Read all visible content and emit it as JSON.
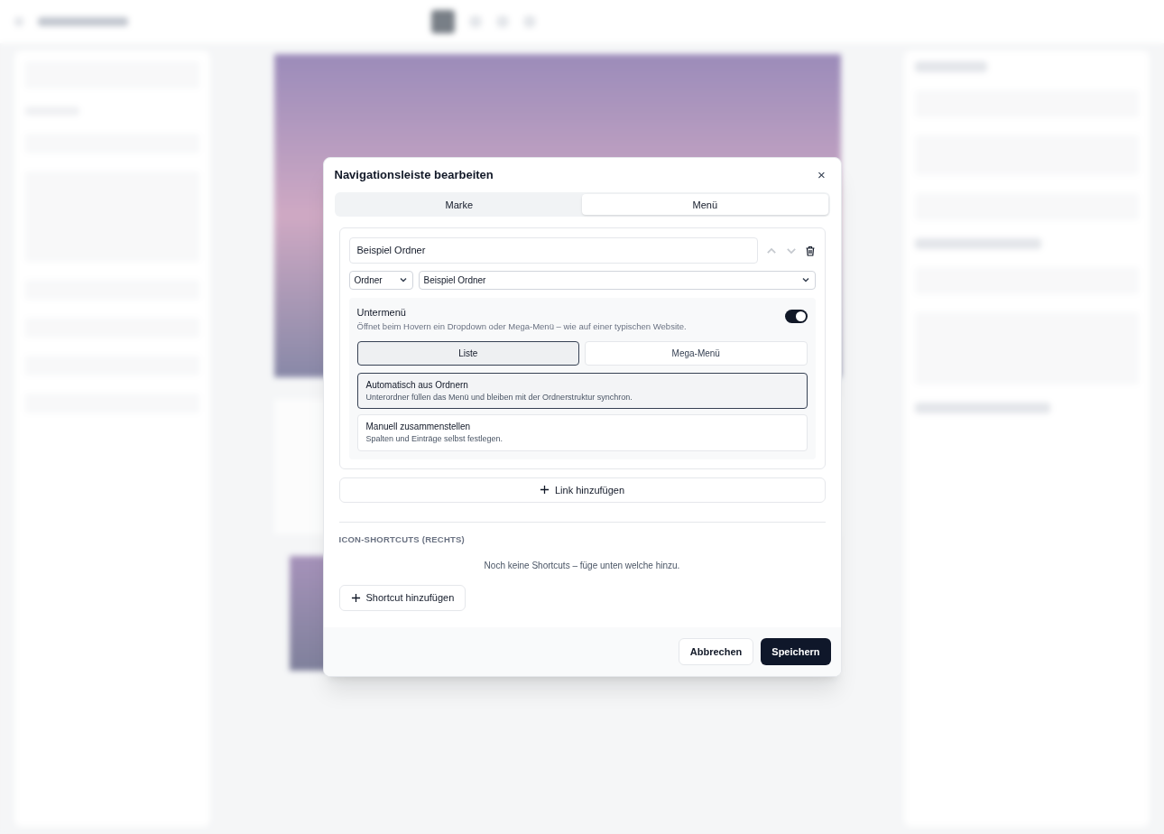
{
  "dialog": {
    "title": "Navigationsleiste bearbeiten",
    "close": "×"
  },
  "tabs": [
    {
      "label": "Marke",
      "selected": false
    },
    {
      "label": "Menü",
      "selected": true
    }
  ],
  "menu_items": [
    {
      "label": "Beispiel Ordner",
      "type": "Ordner",
      "target": "Beispiel Ordner",
      "submenu": {
        "title": "Untermenü",
        "description": "Öffnet beim Hovern ein Dropdown oder Mega-Menü – wie auf einer typischen Website.",
        "on": true,
        "styles": [
          {
            "label": "Liste",
            "selected": true
          },
          {
            "label": "Mega-Menü",
            "selected": false
          }
        ],
        "sources": [
          {
            "title": "Automatisch aus Ordnern",
            "description": "Unterordner füllen das Menü und bleiben mit der Ordnerstruktur synchron.",
            "selected": true
          },
          {
            "title": "Manuell zusammenstellen",
            "description": "Spalten und Einträge selbst festlegen.",
            "selected": false
          }
        ]
      }
    }
  ],
  "add_link": "Link hinzufügen",
  "shortcuts": {
    "heading": "ICON-SHORTCUTS (RECHTS)",
    "empty": "Noch keine Shortcuts – füge unten welche hinzu.",
    "add": "Shortcut hinzufügen"
  },
  "buttons": [
    "Abbrechen",
    "Speichern"
  ]
}
